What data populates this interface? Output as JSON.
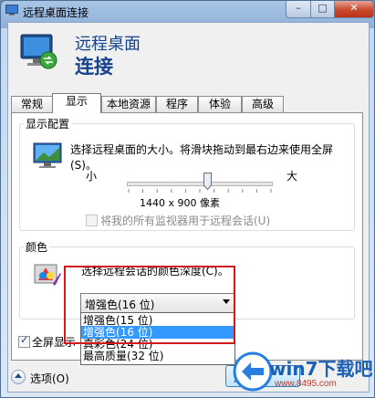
{
  "window": {
    "title": "远程桌面连接"
  },
  "header": {
    "line1": "远程桌面",
    "line2": "连接"
  },
  "tabs": [
    {
      "label": "常规"
    },
    {
      "label": "显示"
    },
    {
      "label": "本地资源"
    },
    {
      "label": "程序"
    },
    {
      "label": "体验"
    },
    {
      "label": "高级"
    }
  ],
  "display_config": {
    "legend": "显示配置",
    "description": "选择远程桌面的大小。将滑块拖动到最右边来使用全屏(S)。",
    "slider": {
      "min_label": "小",
      "max_label": "大",
      "resolution": "1440 x 900 像素",
      "level": 0.56
    },
    "all_monitors_label": "将我的所有监视器用于远程会话(U)"
  },
  "colors": {
    "legend": "颜色",
    "description": "选择远程会话的颜色深度(C)。",
    "selected": "增强色(16 位)",
    "options": [
      {
        "label": "增强色(15 位)"
      },
      {
        "label": "增强色(16 位)"
      },
      {
        "label": "真彩色(24 位)"
      },
      {
        "label": "最高质量(32 位)"
      }
    ],
    "highlighted_index": 1
  },
  "fullscreen_bar": {
    "label": "全屏显示"
  },
  "footer": {
    "options_label": "选项(O)",
    "connect_label": "连"
  },
  "watermark": {
    "brand": "win7下载吧",
    "url": "www.8495.com"
  },
  "accent_colors": {
    "header_blue": "#15428b",
    "selection": "#3399ff",
    "highlight_box": "#d21a1a"
  }
}
